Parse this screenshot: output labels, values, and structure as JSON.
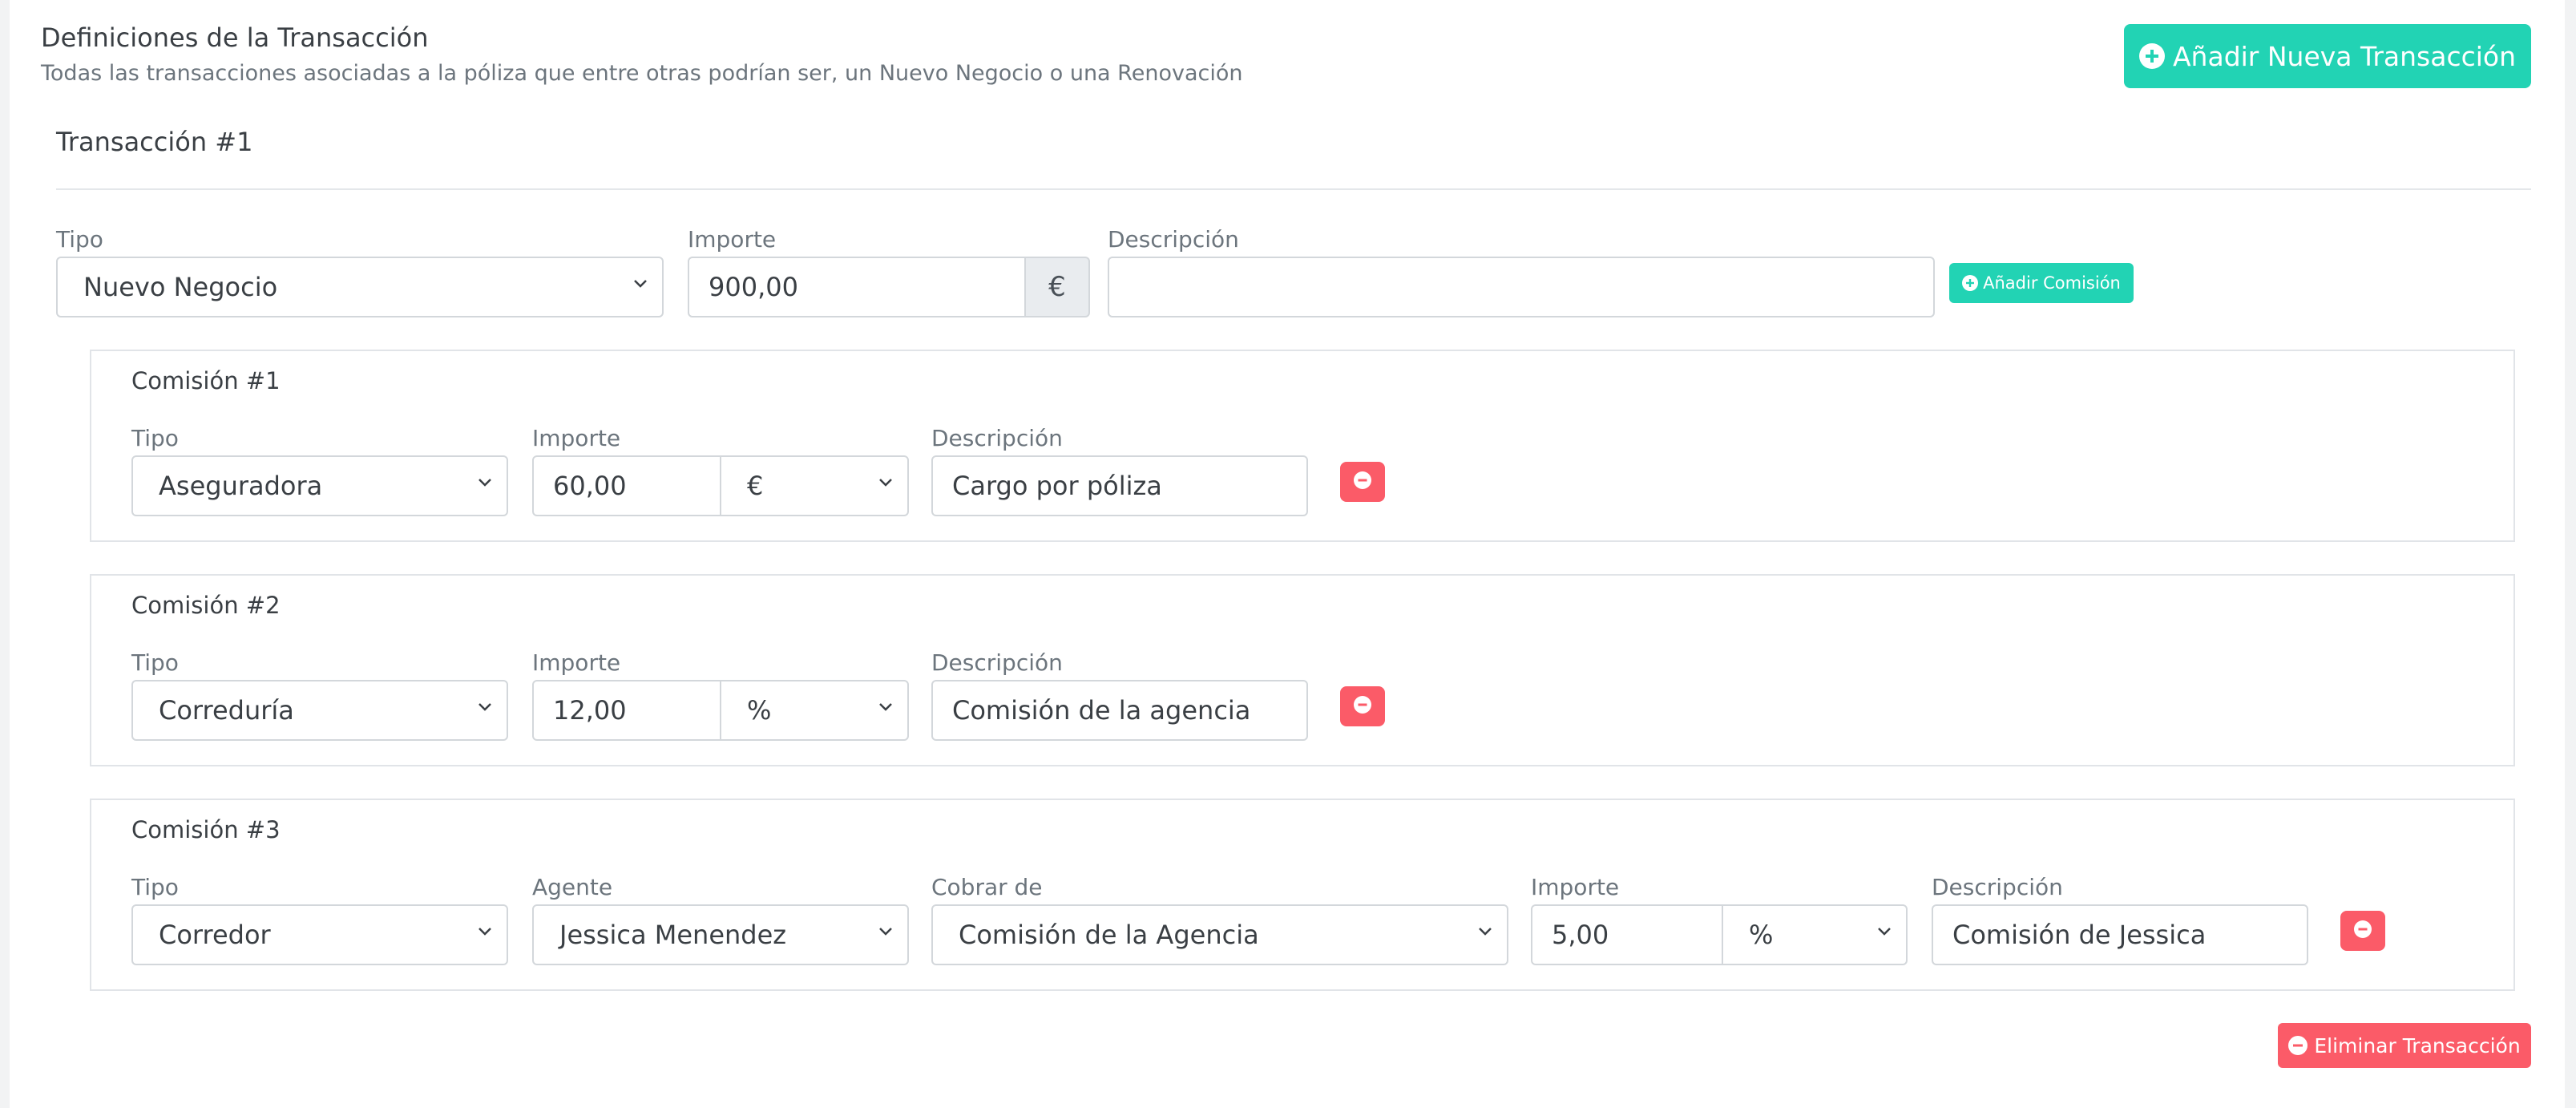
{
  "header": {
    "title": "Definiciones de la Transacción",
    "subtitle": "Todas las transacciones asociadas a la póliza que entre otras podrían ser, un Nuevo Negocio o una Renovación",
    "add_transaction_label": "Añadir Nueva Transacción"
  },
  "transaction": {
    "title": "Transacción #1",
    "tipo_label": "Tipo",
    "tipo_value": "Nuevo Negocio",
    "importe_label": "Importe",
    "importe_value": "900,00",
    "currency": "€",
    "descripcion_label": "Descripción",
    "descripcion_value": "",
    "add_commission_label": "Añadir Comisión",
    "delete_label": "Eliminar Transacción"
  },
  "commissions": [
    {
      "title": "Comisión #1",
      "tipo_label": "Tipo",
      "tipo_value": "Aseguradora",
      "importe_label": "Importe",
      "importe_value": "60,00",
      "unit_value": "€",
      "descripcion_label": "Descripción",
      "descripcion_value": "Cargo por póliza"
    },
    {
      "title": "Comisión #2",
      "tipo_label": "Tipo",
      "tipo_value": "Correduría",
      "importe_label": "Importe",
      "importe_value": "12,00",
      "unit_value": "%",
      "descripcion_label": "Descripción",
      "descripcion_value": "Comisión de la agencia"
    },
    {
      "title": "Comisión #3",
      "tipo_label": "Tipo",
      "tipo_value": "Corredor",
      "agente_label": "Agente",
      "agente_value": "Jessica Menendez",
      "cobrar_label": "Cobrar de",
      "cobrar_value": "Comisión de la Agencia",
      "importe_label": "Importe",
      "importe_value": "5,00",
      "unit_value": "%",
      "descripcion_label": "Descripción",
      "descripcion_value": "Comisión de Jessica"
    }
  ],
  "colors": {
    "accent": "#22d3b4",
    "danger": "#fb5b68",
    "border": "#d3d7db"
  }
}
